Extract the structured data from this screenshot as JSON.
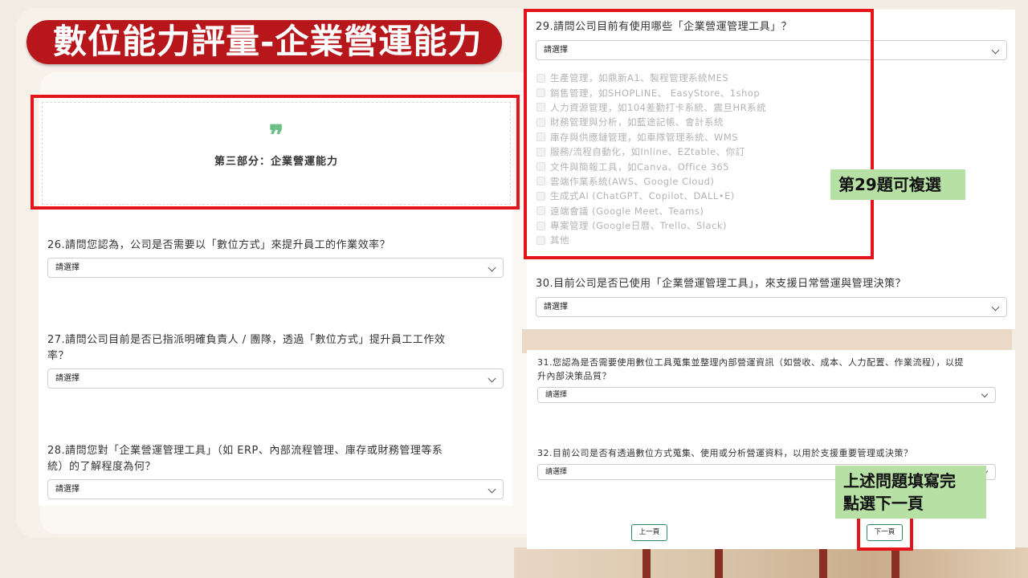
{
  "banner": {
    "title": "數位能力評量-企業營運能力"
  },
  "section": {
    "quote": "❞",
    "title": "第三部分：企業營運能力"
  },
  "select_placeholder": "請選擇",
  "questions": {
    "q26": "26.請問您認為，公司是否需要以「數位方式」來提升員工的作業效率？",
    "q27_line1": "27.請問公司目前是否已指派明確負責人 / 團隊，透過「數位方式」提升員工工作效",
    "q27_line2": "率？",
    "q28_line1": "28.請問您對「企業營運管理工具」（如 ERP、內部流程管理、庫存或財務管理等系",
    "q28_line2": "統）的了解程度為何？",
    "q29": "29.請問公司目前有使用哪些「企業營運管理工具」？",
    "q30": "30.目前公司是否已使用「企業營運管理工具」，來支援日常營運與管理決策？",
    "q31_line1": "31.您認為是否需要使用數位工具蒐集並整理內部營運資訊（如營收、成本、人力配置、作業流程），以提",
    "q31_line2": "升內部決策品質？",
    "q32": "32.目前公司是否有透過數位方式蒐集、使用或分析營運資料，以用於支援重要管理或決策？"
  },
  "q29_options": [
    "生產管理，如鼎新A1、製程管理系統MES",
    "銷售管理，如SHOPLINE、 EasyStore、1shop",
    "人力資源管理，如104差勤打卡系統、震旦HR系統",
    "財務管理與分析，如藍途記帳、會計系統",
    "庫存與供應鏈管理，如車隊管理系統、WMS",
    "服務/流程自動化，如Inline、EZtable、你訂",
    "文件與簡報工具，如Canva、Office 365",
    "雲端作業系統(AWS、Google Cloud)",
    "生成式AI (ChatGPT、Copilot、DALL•E)",
    "遠端會議 (Google Meet、Teams)",
    "專案管理 (Google日曆、Trello、Slack)",
    "其他"
  ],
  "callouts": {
    "multi_select": "第29題可複選",
    "next_line1": "上述問題填寫完",
    "next_line2": "點選下一頁"
  },
  "nav": {
    "prev": "上一頁",
    "next": "下一頁"
  },
  "colors": {
    "banner": "#b7161b",
    "highlight": "#e3141b",
    "callout": "#b7e0a5",
    "button_border": "#2e8a5c",
    "quote": "#6bbf86"
  }
}
